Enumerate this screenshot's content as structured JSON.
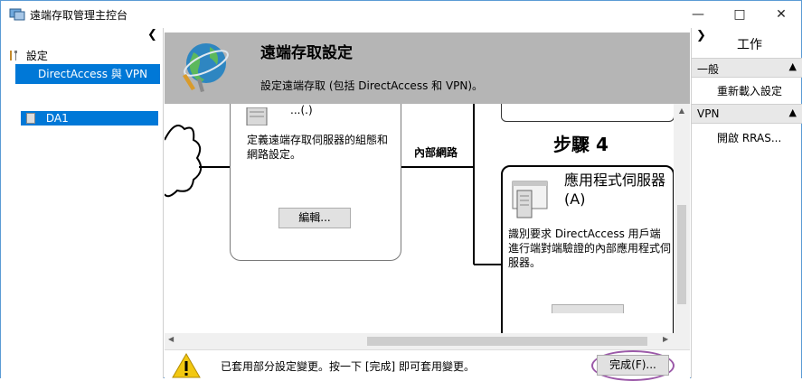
{
  "window": {
    "title": "遠端存取管理主控台"
  },
  "nav": {
    "settings_label": "設定",
    "selected_item": "DirectAccess 與 VPN",
    "server_label": "DA1"
  },
  "header": {
    "title": "遠端存取設定",
    "subtitle": "設定遠端存取 (包括 DirectAccess 和 VPN)。"
  },
  "canvas": {
    "config_box": {
      "title_fragment": "...(.)",
      "description": "定義遠端存取伺服器的組態和網路設定。",
      "edit_button": "編輯..."
    },
    "network_label": "內部網路",
    "step_label": "步驟 4",
    "app_server_box": {
      "name": "應用程式伺服器(A)",
      "description": "識別要求 DirectAccess 用戶端進行端對端驗證的內部應用程式伺服器。"
    }
  },
  "status": {
    "message": "已套用部分設定變更。按一下 [完成] 即可套用變更。",
    "finish_button": "完成(F)..."
  },
  "actions": {
    "title": "工作",
    "sections": [
      {
        "label": "一般",
        "items": [
          "重新載入設定"
        ]
      },
      {
        "label": "VPN",
        "items": [
          "開啟 RRAS..."
        ]
      }
    ]
  },
  "colors": {
    "selection": "#0078d7",
    "header_bg": "#b5b5b5",
    "highlight_oval": "#9b59a8"
  }
}
